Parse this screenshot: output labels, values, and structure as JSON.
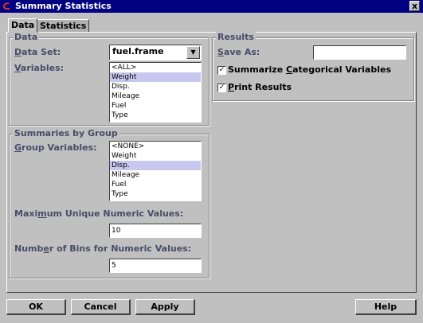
{
  "window": {
    "title": "Summary Statistics",
    "close_glyph": "x"
  },
  "tabs": [
    {
      "label": "Data"
    },
    {
      "label": "Statistics"
    }
  ],
  "data_group": {
    "legend": "Data",
    "dataset_label": "Data Set:",
    "dataset_value": "fuel.frame",
    "dropdown_glyph": "▼",
    "variables_label": "Variables:",
    "variables": [
      "<ALL>",
      "Weight",
      "Disp.",
      "Mileage",
      "Fuel",
      "Type"
    ],
    "variables_selected": "Weight"
  },
  "group_summary": {
    "legend": "Summaries by Group",
    "group_variables_label": "Group Variables:",
    "group_variables": [
      "<NONE>",
      "Weight",
      "Disp.",
      "Mileage",
      "Fuel",
      "Type"
    ],
    "group_variables_selected": "Disp.",
    "max_unique_label": "Maximum Unique Numeric Values:",
    "max_unique_value": "10",
    "num_bins_label": "Number of Bins for Numeric Values:",
    "num_bins_value": "5"
  },
  "results": {
    "legend": "Results",
    "save_as_label": "Save As:",
    "save_as_value": "",
    "summarize_categorical_label": "Summarize Categorical Variables",
    "summarize_categorical_checked": true,
    "print_results_label": "Print Results",
    "print_results_checked": true,
    "check_glyph": "✓"
  },
  "buttons": {
    "ok": "OK",
    "cancel": "Cancel",
    "apply": "Apply",
    "help": "Help"
  },
  "colors": {
    "titlebar": "#000080",
    "face": "#c0c0c0",
    "label": "#4a4a6a",
    "selection": "#c8c8ee"
  }
}
